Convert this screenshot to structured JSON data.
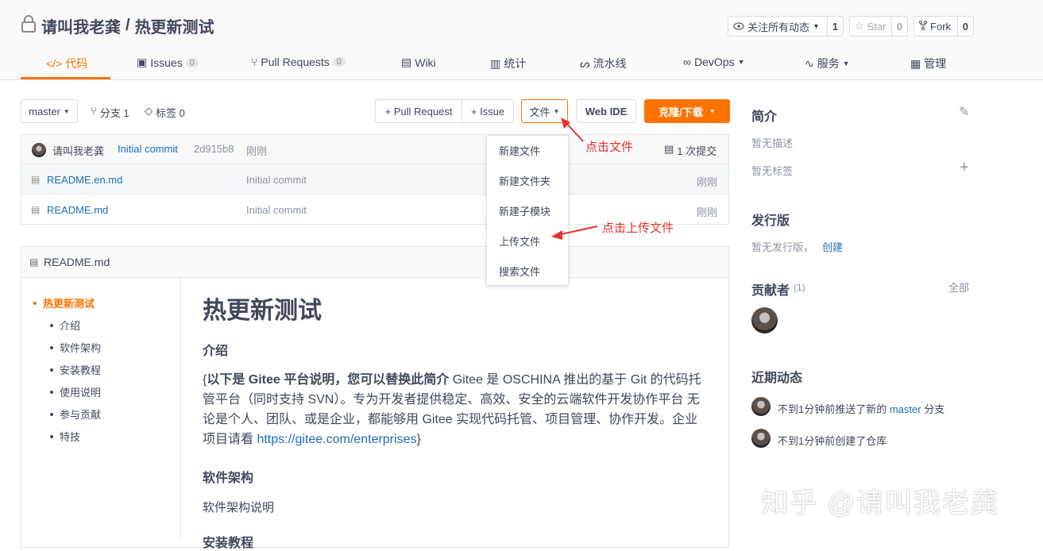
{
  "repo": {
    "owner": "请叫我老龚",
    "name": "热更新测试",
    "separator": "/"
  },
  "header_buttons": {
    "watch": {
      "label": "关注所有动态",
      "count": "1"
    },
    "star": {
      "label": "Star",
      "count": "0"
    },
    "fork": {
      "label": "Fork",
      "count": "0"
    }
  },
  "tabs": [
    {
      "label": "代码"
    },
    {
      "label": "Issues",
      "badge": "0"
    },
    {
      "label": "Pull Requests",
      "badge": "0"
    },
    {
      "label": "Wiki"
    },
    {
      "label": "统计"
    },
    {
      "label": "流水线"
    },
    {
      "label": "DevOps"
    },
    {
      "label": "服务"
    },
    {
      "label": "管理"
    }
  ],
  "toolbar": {
    "branch": "master",
    "branches": "分支 1",
    "tags": "标签 0",
    "pull_request": "+ Pull Request",
    "issue": "+ Issue",
    "file": "文件",
    "webide": "Web IDE",
    "clone": "克隆/下载"
  },
  "commit": {
    "author": "请叫我老龚",
    "message": "Initial commit",
    "hash": "2d915b8",
    "time": "刚刚",
    "count": "1 次提交"
  },
  "files": [
    {
      "name": "README.en.md",
      "message": "Initial commit",
      "time": "刚刚"
    },
    {
      "name": "README.md",
      "message": "Initial commit",
      "time": "刚刚"
    }
  ],
  "file_menu": [
    "新建文件",
    "新建文件夹",
    "新建子模块",
    "上传文件",
    "搜索文件"
  ],
  "annotations": {
    "click_file": "点击文件",
    "click_upload": "点击上传文件"
  },
  "readme": {
    "filename": "README.md",
    "toc": [
      "热更新测试",
      "介绍",
      "软件架构",
      "安装教程",
      "使用说明",
      "参与贡献",
      "特技"
    ],
    "title": "热更新测试",
    "h_intro": "介绍",
    "intro_prefix": "{",
    "intro_bold": "以下是 Gitee 平台说明，您可以替换此简介",
    "intro_line1_rest": " Gitee 是 OSCHINA 推出的基于 Git 的代码托",
    "intro_line2": "管平台（同时支持 SVN）。专为开发者提供稳定、高效、安全的云端软件开发协作平台 无",
    "intro_line3": "论是个人、团队、或是企业，都能够用 Gitee 实现代码托管、项目管理、协作开发。企业",
    "intro_line4_prefix": "项目请看 ",
    "intro_link": "https://gitee.com/enterprises",
    "intro_suffix": "}",
    "h_arch": "软件架构",
    "arch_text": "软件架构说明",
    "h_install": "安装教程"
  },
  "sidebar": {
    "intro_title": "简介",
    "no_desc": "暂无描述",
    "no_tags": "暂无标签",
    "release_title": "发行版",
    "no_release": "暂无发行版，",
    "create": "创建",
    "contrib_title": "贡献者",
    "contrib_count": "(1)",
    "all": "全部",
    "activity_title": "近期动态",
    "activity1_prefix": "不到1分钟前推送了新的 ",
    "activity1_branch": "master",
    "activity1_suffix": " 分支",
    "activity2": "不到1分钟前创建了仓库"
  },
  "watermark": "知乎 @请叫我老龚",
  "colors": {
    "accent": "#fe7300",
    "link": "#1f6eb4",
    "annotation": "#e5322d"
  }
}
